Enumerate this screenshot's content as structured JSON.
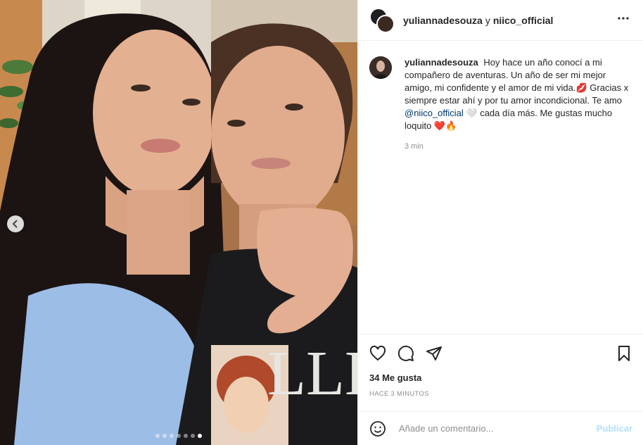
{
  "post": {
    "header": {
      "user1": "yuliannadesouza",
      "separator": "y",
      "user2": "niico_official",
      "more_icon": "more-horizontal-icon"
    },
    "caption": {
      "username": "yuliannadesouza",
      "text_part1": "Hoy hace un año conocí a mi compañero de aventuras. Un año de ser mi mejor amigo, mi confidente y el amor de mi vida.💋 Gracias x siempre estar ahí y por tu amor incondicional. Te amo",
      "mention": "@niico_official",
      "text_part2": "🤍 cada día más. Me gustas mucho loquito ❤️🔥",
      "time": "3 min"
    },
    "actions": {
      "like_icon": "heart-icon",
      "comment_icon": "comment-icon",
      "share_icon": "send-icon",
      "save_icon": "bookmark-icon"
    },
    "likes_text": "34 Me gusta",
    "timestamp": "HACE 3 MINUTOS",
    "comment": {
      "emoji_icon": "emoji-icon",
      "placeholder": "Añade un comentario...",
      "publish_label": "Publicar"
    },
    "carousel": {
      "prev_icon": "chevron-left-icon",
      "slide_count": 7,
      "active_index": 0
    }
  }
}
